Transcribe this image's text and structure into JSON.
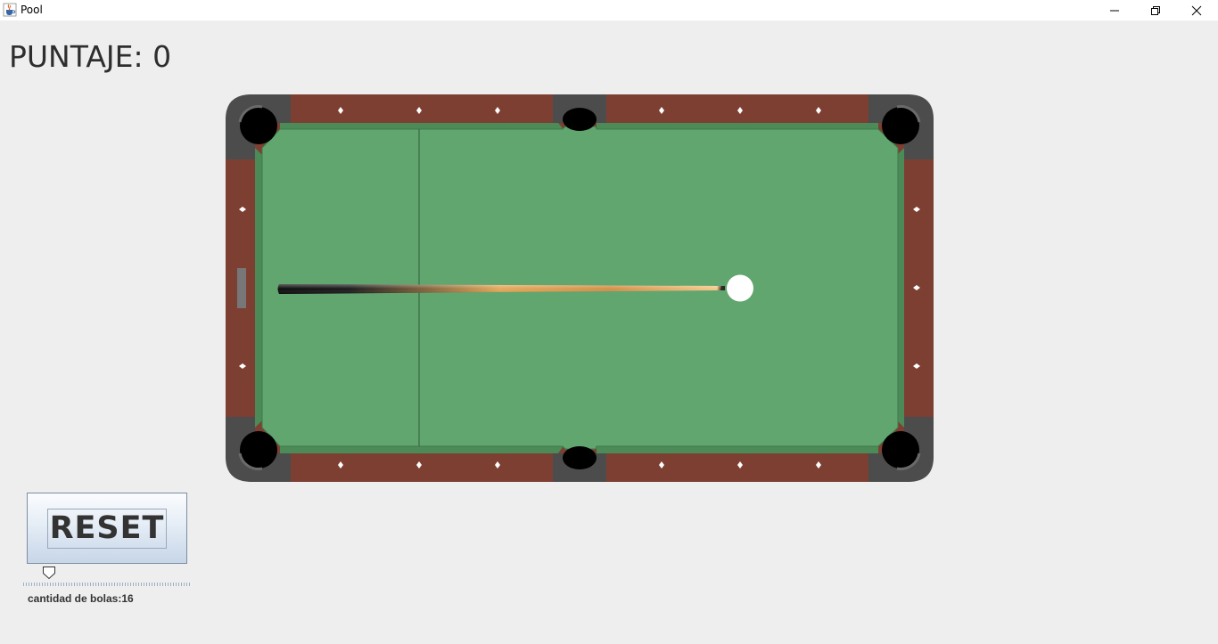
{
  "window": {
    "title": "Pool",
    "icon": "java-cup-icon"
  },
  "controls": {
    "minimize": "minimize-icon",
    "maximize": "restore-icon",
    "close": "close-icon"
  },
  "score": {
    "label": "PUNTAJE:",
    "value": "0"
  },
  "table": {
    "cue_ball_color": "#ffffff",
    "felt_color": "#61a56f",
    "rail_color": "#7d3f32"
  },
  "reset": {
    "label": "RESET"
  },
  "slider": {
    "caption": "cantidad de bolas:16",
    "value": 16
  }
}
